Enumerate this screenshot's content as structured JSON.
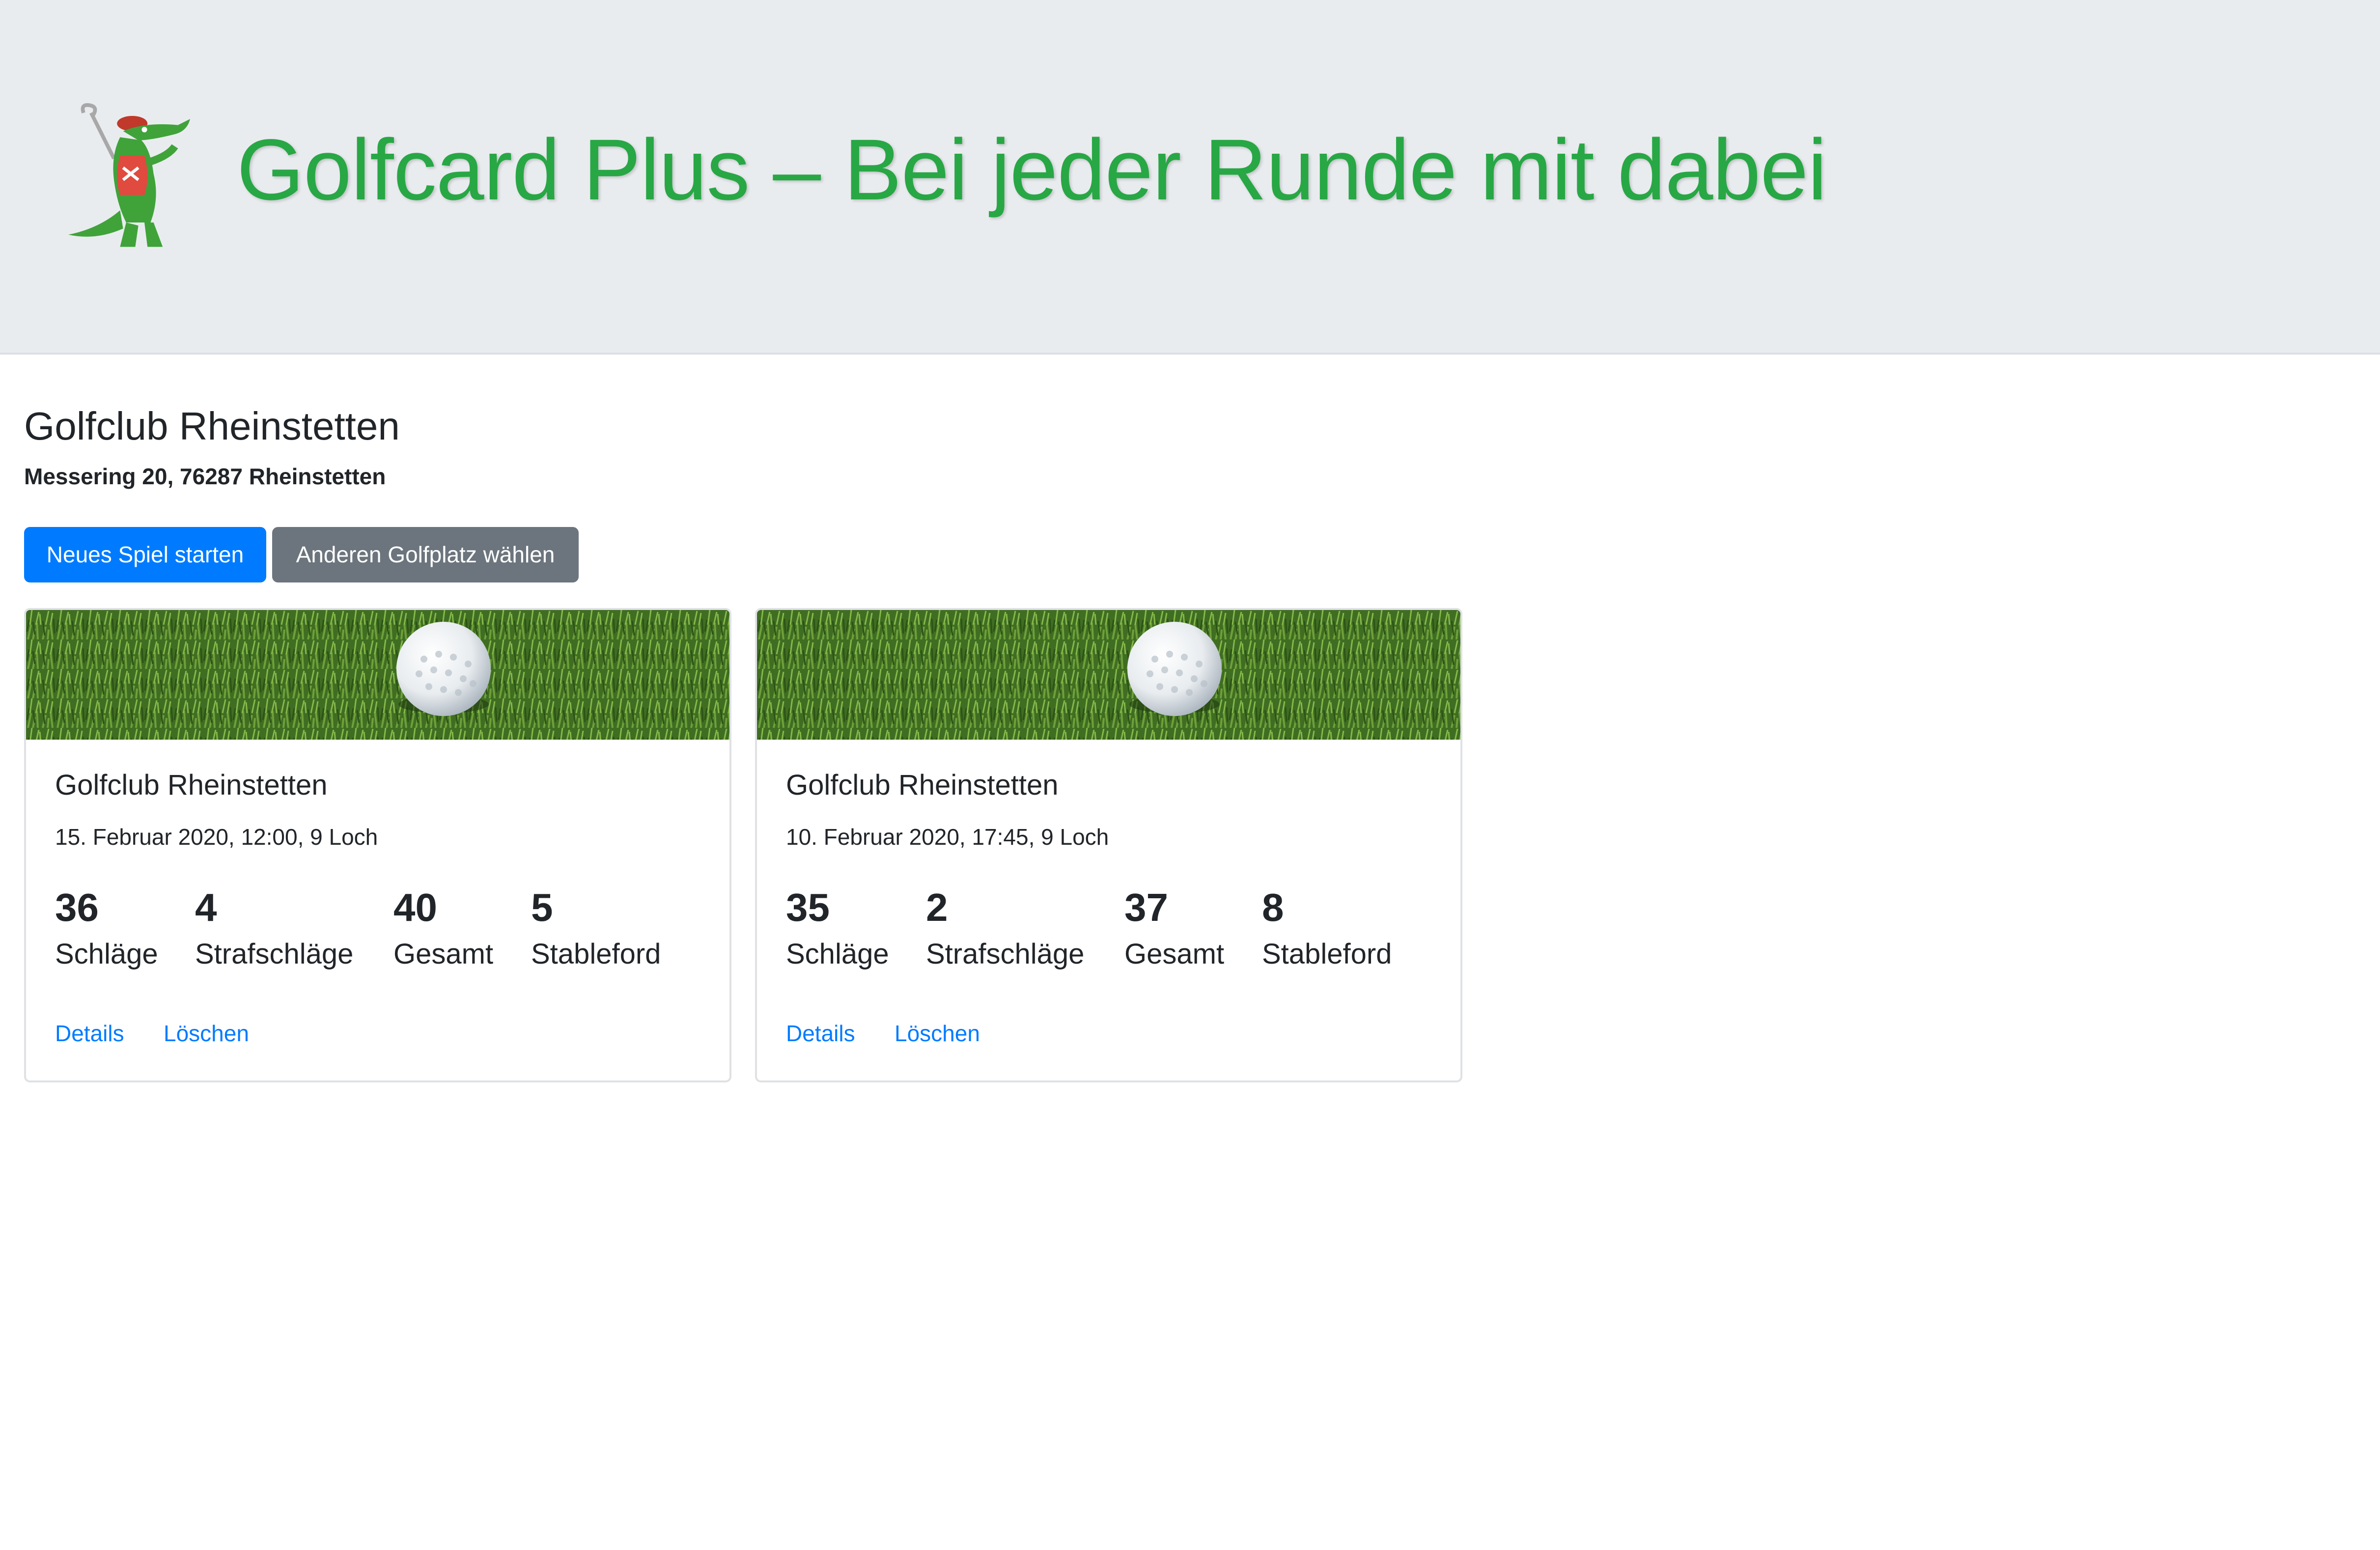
{
  "header": {
    "title": "Golfcard Plus – Bei jeder Runde mit dabei",
    "logo_icon": "crocodile-golfer-mascot-icon"
  },
  "club": {
    "name": "Golfclub Rheinstetten",
    "address": "Messering 20, 76287 Rheinstetten"
  },
  "actions": {
    "new_game": "Neues Spiel starten",
    "choose_course": "Anderen Golfplatz wählen"
  },
  "colors": {
    "title_green": "#28a745",
    "primary": "#007bff",
    "secondary": "#6c757d",
    "jumbotron_bg": "#e9ecef"
  },
  "rounds": [
    {
      "club": "Golfclub Rheinstetten",
      "date": "15. Februar 2020, 12:00, 9 Loch",
      "strokes": "36",
      "strokes_label": "Schläge",
      "penalties": "4",
      "penalties_label": "Strafschläge",
      "total": "40",
      "total_label": "Gesamt",
      "stableford": "5",
      "stableford_label": "Stableford",
      "details": "Details",
      "delete": "Löschen",
      "image_icon": "golf-ball-on-grass-icon"
    },
    {
      "club": "Golfclub Rheinstetten",
      "date": "10. Februar 2020, 17:45, 9 Loch",
      "strokes": "35",
      "strokes_label": "Schläge",
      "penalties": "2",
      "penalties_label": "Strafschläge",
      "total": "37",
      "total_label": "Gesamt",
      "stableford": "8",
      "stableford_label": "Stableford",
      "details": "Details",
      "delete": "Löschen",
      "image_icon": "golf-ball-on-grass-icon"
    }
  ]
}
